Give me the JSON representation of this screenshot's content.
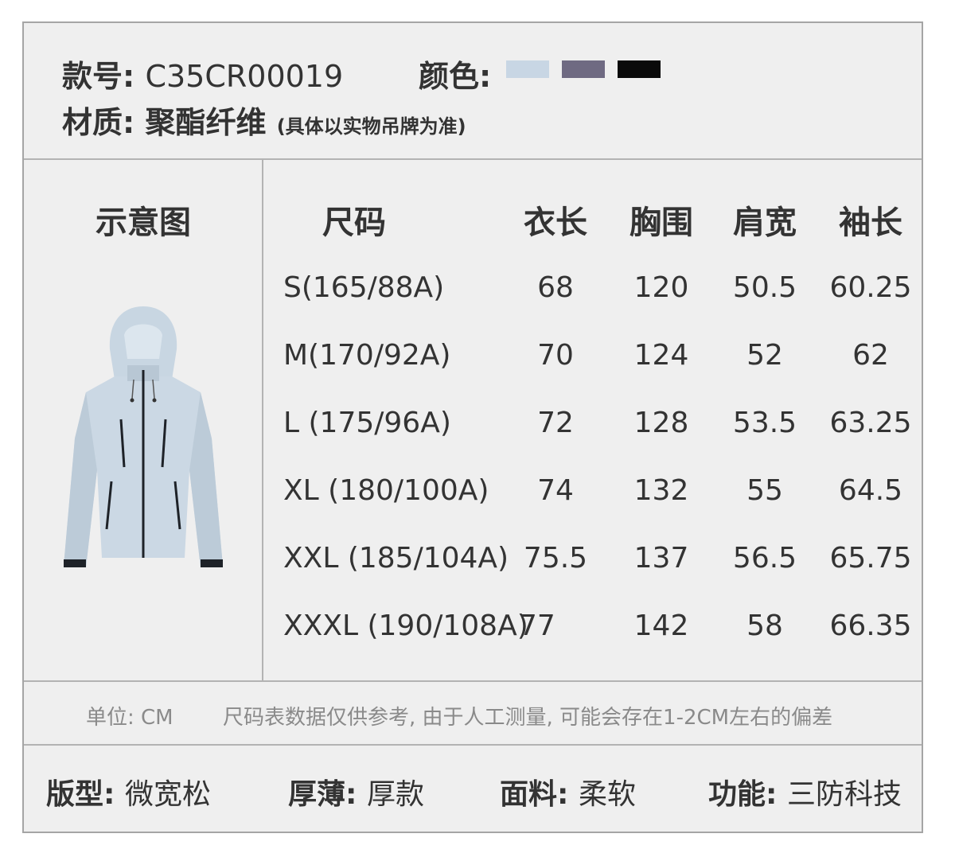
{
  "header": {
    "style_label": "款号:",
    "style_value": "C35CR00019",
    "color_label": "颜色:",
    "colors": [
      "#c8d6e4",
      "#6f6a82",
      "#0a0a0a"
    ],
    "material_label": "材质:",
    "material_value": "聚酯纤维",
    "material_note": "(具体以实物吊牌为准)"
  },
  "diagram_label": "示意图",
  "table": {
    "headers": [
      "尺码",
      "衣长",
      "胸围",
      "肩宽",
      "袖长"
    ],
    "rows": [
      [
        "S(165/88A)",
        "68",
        "120",
        "50.5",
        "60.25"
      ],
      [
        "M(170/92A)",
        "70",
        "124",
        "52",
        "62"
      ],
      [
        "L (175/96A)",
        "72",
        "128",
        "53.5",
        "63.25"
      ],
      [
        "XL (180/100A)",
        "74",
        "132",
        "55",
        "64.5"
      ],
      [
        "XXL (185/104A)",
        "75.5",
        "137",
        "56.5",
        "65.75"
      ],
      [
        "XXXL (190/108A)",
        "77",
        "142",
        "58",
        "66.35"
      ]
    ]
  },
  "footnote": {
    "unit": "单位: CM",
    "disclaimer": "尺码表数据仅供参考, 由于人工测量, 可能会存在1-2CM左右的偏差"
  },
  "attributes": [
    {
      "label": "版型:",
      "value": "微宽松"
    },
    {
      "label": "厚薄:",
      "value": "厚款"
    },
    {
      "label": "面料:",
      "value": "柔软"
    },
    {
      "label": "功能:",
      "value": "三防科技"
    }
  ]
}
